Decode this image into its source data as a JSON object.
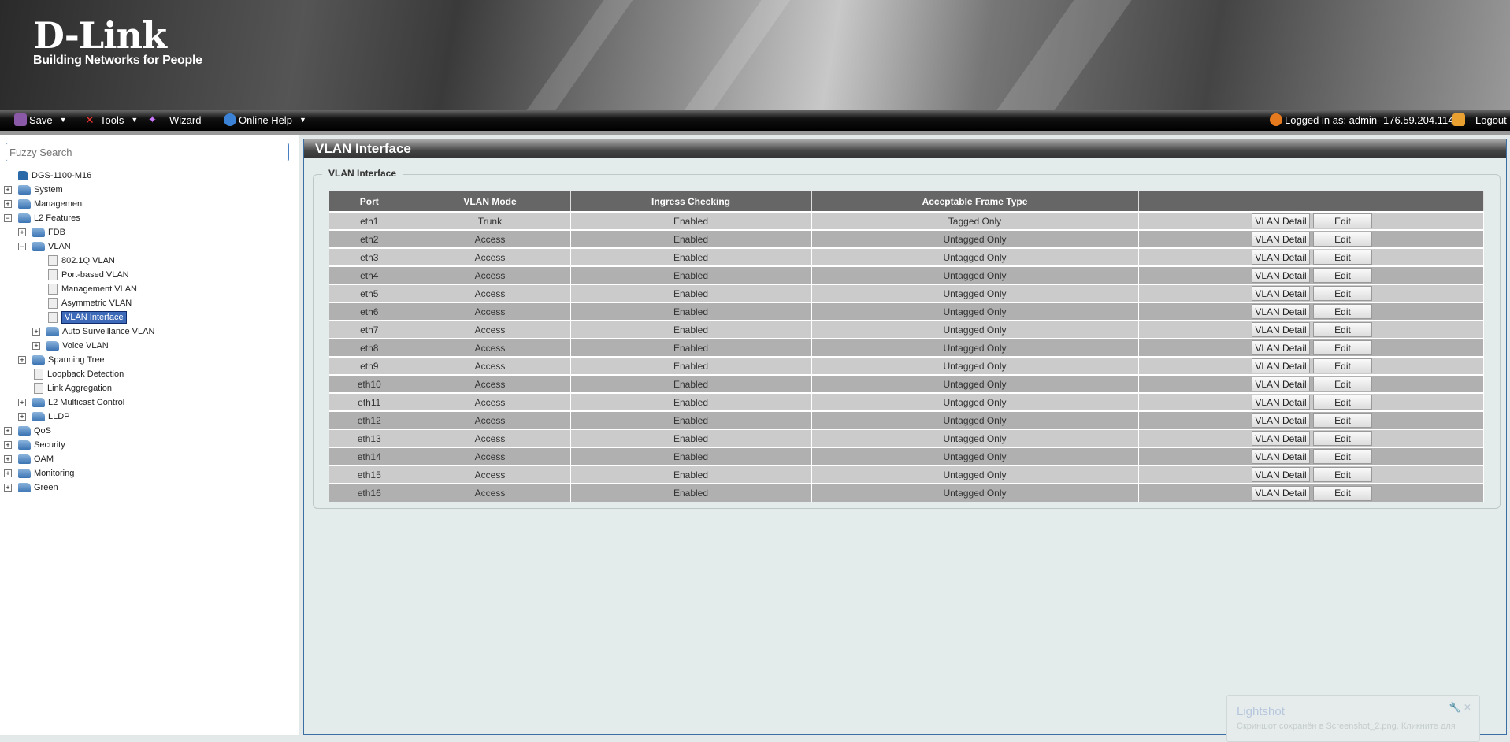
{
  "brand": {
    "logo": "D-Link",
    "tagline": "Building Networks for People"
  },
  "toolbar": {
    "save": "Save",
    "tools": "Tools",
    "wizard": "Wizard",
    "help": "Online Help",
    "logged_in": "Logged in as: admin- 176.59.204.114",
    "logout": "Logout"
  },
  "sidebar": {
    "search_placeholder": "Fuzzy Search",
    "items": [
      {
        "label": "DGS-1100-M16",
        "level": 0,
        "type": "device"
      },
      {
        "label": "System",
        "level": 0,
        "type": "folder",
        "exp": "+"
      },
      {
        "label": "Management",
        "level": 0,
        "type": "folder",
        "exp": "+"
      },
      {
        "label": "L2 Features",
        "level": 0,
        "type": "folder",
        "exp": "-"
      },
      {
        "label": "FDB",
        "level": 1,
        "type": "folder",
        "exp": "+"
      },
      {
        "label": "VLAN",
        "level": 1,
        "type": "folder",
        "exp": "-"
      },
      {
        "label": "802.1Q VLAN",
        "level": 2,
        "type": "doc"
      },
      {
        "label": "Port-based VLAN",
        "level": 2,
        "type": "doc"
      },
      {
        "label": "Management VLAN",
        "level": 2,
        "type": "doc"
      },
      {
        "label": "Asymmetric VLAN",
        "level": 2,
        "type": "doc"
      },
      {
        "label": "VLAN Interface",
        "level": 2,
        "type": "doc",
        "selected": true
      },
      {
        "label": "Auto Surveillance VLAN",
        "level": 2,
        "type": "folder",
        "exp": "+"
      },
      {
        "label": "Voice VLAN",
        "level": 2,
        "type": "folder",
        "exp": "+"
      },
      {
        "label": "Spanning Tree",
        "level": 1,
        "type": "folder",
        "exp": "+"
      },
      {
        "label": "Loopback Detection",
        "level": 1,
        "type": "doc"
      },
      {
        "label": "Link Aggregation",
        "level": 1,
        "type": "doc"
      },
      {
        "label": "L2 Multicast Control",
        "level": 1,
        "type": "folder",
        "exp": "+"
      },
      {
        "label": "LLDP",
        "level": 1,
        "type": "folder",
        "exp": "+"
      },
      {
        "label": "QoS",
        "level": 0,
        "type": "folder",
        "exp": "+"
      },
      {
        "label": "Security",
        "level": 0,
        "type": "folder",
        "exp": "+"
      },
      {
        "label": "OAM",
        "level": 0,
        "type": "folder",
        "exp": "+"
      },
      {
        "label": "Monitoring",
        "level": 0,
        "type": "folder",
        "exp": "+"
      },
      {
        "label": "Green",
        "level": 0,
        "type": "folder",
        "exp": "+"
      }
    ]
  },
  "main": {
    "title": "VLAN Interface",
    "legend": "VLAN Interface",
    "columns": [
      "Port",
      "VLAN Mode",
      "Ingress Checking",
      "Acceptable Frame Type",
      ""
    ],
    "detail_label": "VLAN Detail",
    "edit_label": "Edit",
    "rows": [
      [
        "eth1",
        "Trunk",
        "Enabled",
        "Tagged Only"
      ],
      [
        "eth2",
        "Access",
        "Enabled",
        "Untagged Only"
      ],
      [
        "eth3",
        "Access",
        "Enabled",
        "Untagged Only"
      ],
      [
        "eth4",
        "Access",
        "Enabled",
        "Untagged Only"
      ],
      [
        "eth5",
        "Access",
        "Enabled",
        "Untagged Only"
      ],
      [
        "eth6",
        "Access",
        "Enabled",
        "Untagged Only"
      ],
      [
        "eth7",
        "Access",
        "Enabled",
        "Untagged Only"
      ],
      [
        "eth8",
        "Access",
        "Enabled",
        "Untagged Only"
      ],
      [
        "eth9",
        "Access",
        "Enabled",
        "Untagged Only"
      ],
      [
        "eth10",
        "Access",
        "Enabled",
        "Untagged Only"
      ],
      [
        "eth11",
        "Access",
        "Enabled",
        "Untagged Only"
      ],
      [
        "eth12",
        "Access",
        "Enabled",
        "Untagged Only"
      ],
      [
        "eth13",
        "Access",
        "Enabled",
        "Untagged Only"
      ],
      [
        "eth14",
        "Access",
        "Enabled",
        "Untagged Only"
      ],
      [
        "eth15",
        "Access",
        "Enabled",
        "Untagged Only"
      ],
      [
        "eth16",
        "Access",
        "Enabled",
        "Untagged Only"
      ]
    ]
  },
  "toast": {
    "title": "Lightshot",
    "message": "Скриншот сохранён в Screenshot_2.png. Кликните для"
  }
}
